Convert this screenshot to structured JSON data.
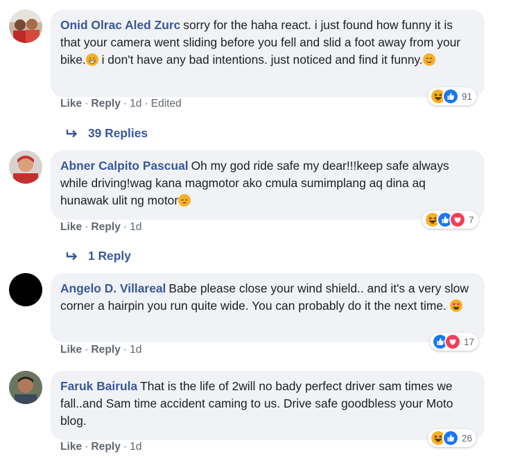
{
  "comments": [
    {
      "author": "Onid Olrac Aled Zurc",
      "text1": "sorry for the haha react. i just found how funny it is that your camera went sliding before you fell and slid a foot away from your bike.",
      "text2": " i don't have any bad intentions. just noticed and find it funny.",
      "actions": {
        "like": "Like",
        "reply": "Reply",
        "time": "1d",
        "edited": "Edited"
      },
      "reaction_count": "91",
      "replies": "39 Replies"
    },
    {
      "author": "Abner Calpito Pascual",
      "text1": "Oh my god ride safe my dear!!!keep safe always while driving!wag kana magmotor ako cmula sumimplang aq dina aq hunawak ulit ng motor",
      "actions": {
        "like": "Like",
        "reply": "Reply",
        "time": "1d"
      },
      "reaction_count": "7",
      "replies": "1 Reply"
    },
    {
      "author": "Angelo D. Villareal",
      "text1": "Babe please close your wind shield.. and it's a very slow corner a hairpin you run quite wide. You can probably do it the next time.",
      "actions": {
        "like": "Like",
        "reply": "Reply",
        "time": "1d"
      },
      "reaction_count": "17"
    },
    {
      "author": "Faruk Bairula",
      "text1": "That is the life of 2will no bady perfect driver sam times we fall..and Sam time accident caming to us. Drive safe goodbless your Moto blog.",
      "actions": {
        "like": "Like",
        "reply": "Reply",
        "time": "1d"
      },
      "reaction_count": "26"
    }
  ],
  "colors": {
    "link": "#385898",
    "bubble": "#f0f2f5",
    "meta": "#606770",
    "like_blue": "#1877f2",
    "love_red": "#f33e58",
    "haha_yellow": "#f7b125"
  }
}
